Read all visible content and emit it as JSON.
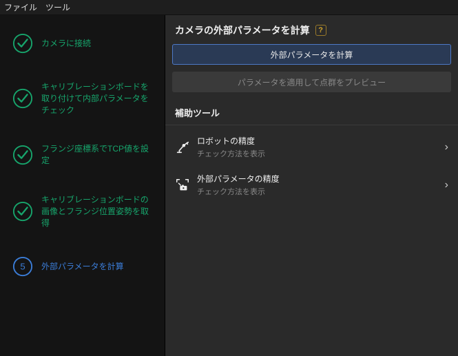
{
  "menubar": {
    "file": "ファイル",
    "tools": "ツール"
  },
  "sidebar": {
    "steps": [
      {
        "label": "カメラに接続",
        "state": "done"
      },
      {
        "label": "キャリブレーションボードを取り付けて内部パラメータをチェック",
        "state": "done"
      },
      {
        "label": "フランジ座標系でTCP値を設定",
        "state": "done"
      },
      {
        "label": "キャリブレーションボードの画像とフランジ位置姿勢を取得",
        "state": "done"
      },
      {
        "label": "外部パラメータを計算",
        "state": "current",
        "number": "5"
      }
    ]
  },
  "main": {
    "header": "カメラの外部パラメータを計算",
    "help_symbol": "?",
    "primary_button": "外部パラメータを計算",
    "secondary_button": "パラメータを適用して点群をプレビュー",
    "aux_section": "補助ツール",
    "tools": [
      {
        "title": "ロボットの精度",
        "sub": "チェック方法を表示"
      },
      {
        "title": "外部パラメータの精度",
        "sub": "チェック方法を表示"
      }
    ]
  }
}
